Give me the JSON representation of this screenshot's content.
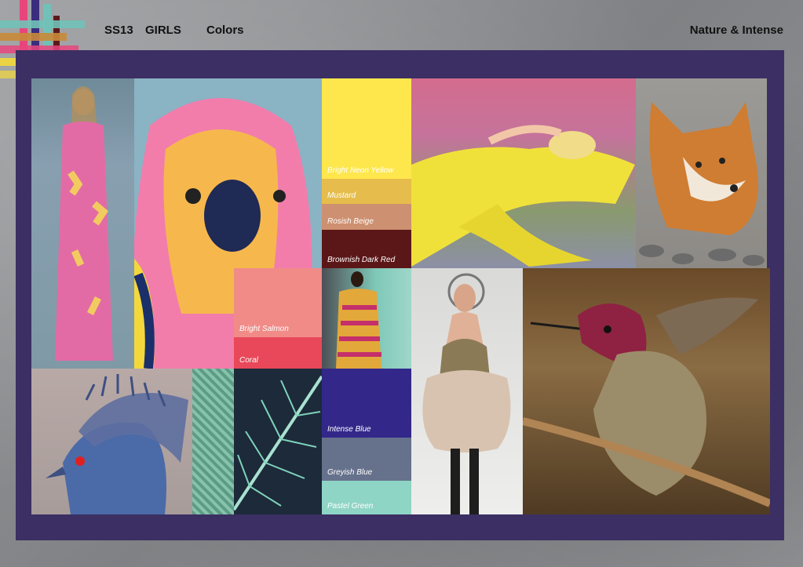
{
  "header": {
    "season": "SS13",
    "category": "GIRLS",
    "topic": "Colors",
    "theme": "Nature & Intense"
  },
  "logo": {
    "colors": [
      "#e7457c",
      "#3a2d7d",
      "#f4d83b",
      "#70c2b8",
      "#c9893a",
      "#5b1a1a"
    ]
  },
  "palette": {
    "accent": "#3b2f63",
    "swatches": [
      {
        "name": "Bright Neon Yellow",
        "color": "#fde74c"
      },
      {
        "name": "Mustard",
        "color": "#e6bd4c"
      },
      {
        "name": "Rosish Beige",
        "color": "#cd9070"
      },
      {
        "name": "Brownish Dark Red",
        "color": "#5b1718"
      },
      {
        "name": "Bright Salmon",
        "color": "#f08b87"
      },
      {
        "name": "Coral",
        "color": "#e8485a"
      },
      {
        "name": "Intense Blue",
        "color": "#33288a"
      },
      {
        "name": "Greyish Blue",
        "color": "#66718c"
      },
      {
        "name": "Pastel Green",
        "color": "#8fd5c5"
      }
    ]
  }
}
